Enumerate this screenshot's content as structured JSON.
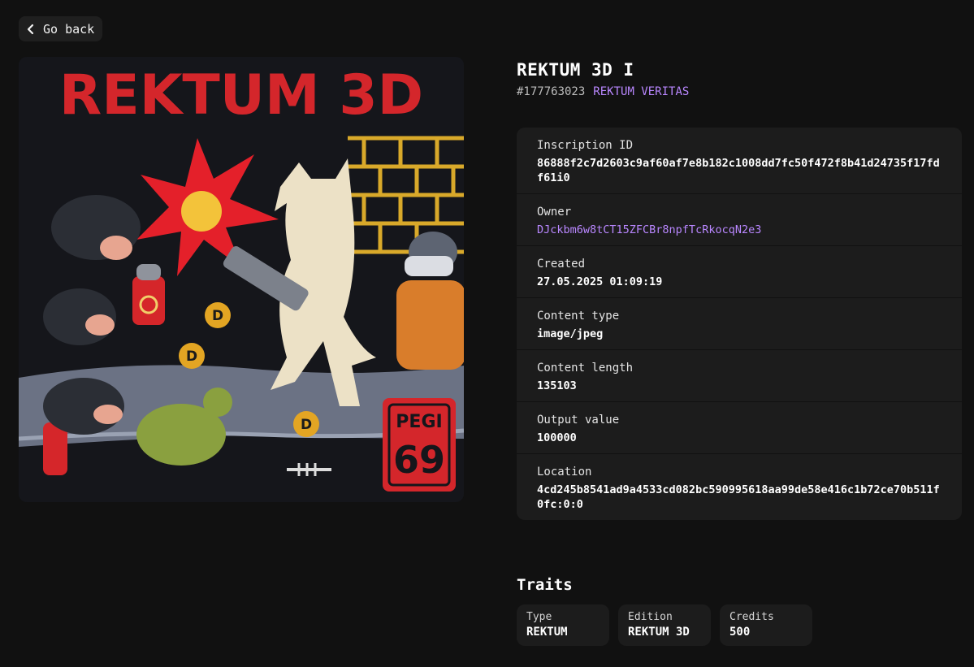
{
  "nav": {
    "back_label": "Go back"
  },
  "artwork": {
    "title_text": "REKTUM 3D",
    "badge_top": "PEGI",
    "badge_bottom": "69"
  },
  "header": {
    "title": "REKTUM 3D I",
    "number": "#177763023",
    "collection": "REKTUM VERITAS"
  },
  "details": [
    {
      "label": "Inscription ID",
      "value": "86888f2c7d2603c9af60af7e8b182c1008dd7fc50f472f8b41d24735f17fdf61i0"
    },
    {
      "label": "Owner",
      "value": "DJckbm6w8tCT15ZFCBr8npfTcRkocqN2e3"
    },
    {
      "label": "Created",
      "value": "27.05.2025 01:09:19"
    },
    {
      "label": "Content type",
      "value": "image/jpeg"
    },
    {
      "label": "Content length",
      "value": "135103"
    },
    {
      "label": "Output value",
      "value": "100000"
    },
    {
      "label": "Location",
      "value": "4cd245b8541ad9a4533cd082bc590995618aa99de58e416c1b72ce70b511f0fc:0:0"
    }
  ],
  "traits_heading": "Traits",
  "traits": [
    {
      "label": "Type",
      "value": "REKTUM"
    },
    {
      "label": "Edition",
      "value": "REKTUM 3D"
    },
    {
      "label": "Credits",
      "value": "500"
    }
  ],
  "colors": {
    "background": "#111111",
    "panel": "#1c1c1c",
    "accent": "#b987ff"
  }
}
